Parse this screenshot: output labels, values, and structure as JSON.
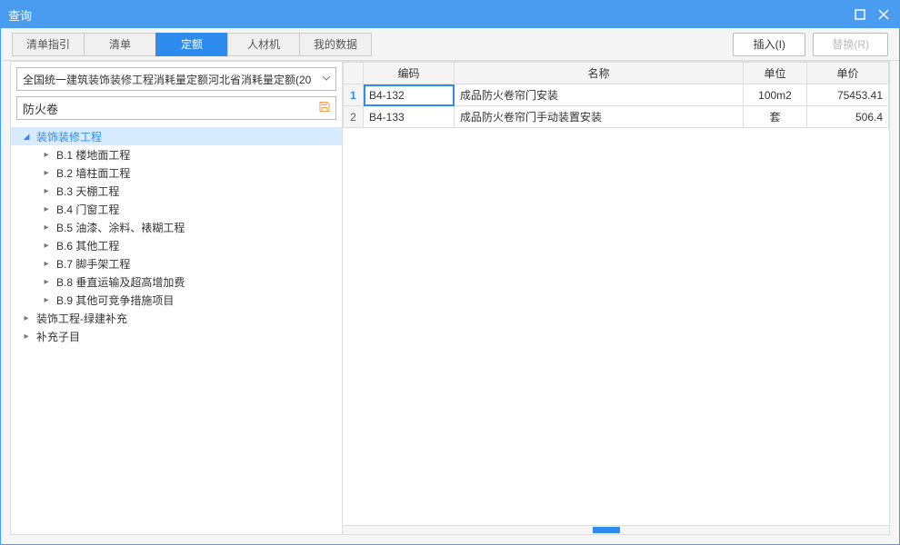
{
  "titlebar": {
    "title": "查询"
  },
  "tabs": [
    {
      "label": "清单指引"
    },
    {
      "label": "清单"
    },
    {
      "label": "定额"
    },
    {
      "label": "人材机"
    },
    {
      "label": "我的数据"
    }
  ],
  "active_tab_index": 2,
  "buttons": {
    "insert": "插入(I)",
    "replace": "替换(R)"
  },
  "dropdown": {
    "selected": "全国统一建筑装饰装修工程消耗量定额河北省消耗量定额(20"
  },
  "search": {
    "value": "防火卷",
    "placeholder": ""
  },
  "tree": [
    {
      "label": "装饰装修工程",
      "level": 1,
      "expanded": true,
      "selected": true
    },
    {
      "label": "B.1 楼地面工程",
      "level": 2,
      "expanded": false
    },
    {
      "label": "B.2 墙柱面工程",
      "level": 2,
      "expanded": false
    },
    {
      "label": "B.3 天棚工程",
      "level": 2,
      "expanded": false
    },
    {
      "label": "B.4 门窗工程",
      "level": 2,
      "expanded": false
    },
    {
      "label": "B.5 油漆、涂料、裱糊工程",
      "level": 2,
      "expanded": false
    },
    {
      "label": "B.6 其他工程",
      "level": 2,
      "expanded": false
    },
    {
      "label": "B.7 脚手架工程",
      "level": 2,
      "expanded": false
    },
    {
      "label": "B.8 垂直运输及超高增加费",
      "level": 2,
      "expanded": false
    },
    {
      "label": "B.9 其他可竞争措施项目",
      "level": 2,
      "expanded": false
    },
    {
      "label": "装饰工程-绿建补充",
      "level": 1,
      "expanded": false
    },
    {
      "label": "补充子目",
      "level": 1,
      "expanded": false
    }
  ],
  "table": {
    "headers": {
      "code": "编码",
      "name": "名称",
      "unit": "单位",
      "price": "单价"
    },
    "rows": [
      {
        "n": "1",
        "code": "B4-132",
        "name": "成品防火卷帘门安装",
        "unit": "100m2",
        "price": "75453.41",
        "selected": true
      },
      {
        "n": "2",
        "code": "B4-133",
        "name": "成品防火卷帘门手动装置安装",
        "unit": "套",
        "price": "506.4",
        "selected": false
      }
    ]
  }
}
